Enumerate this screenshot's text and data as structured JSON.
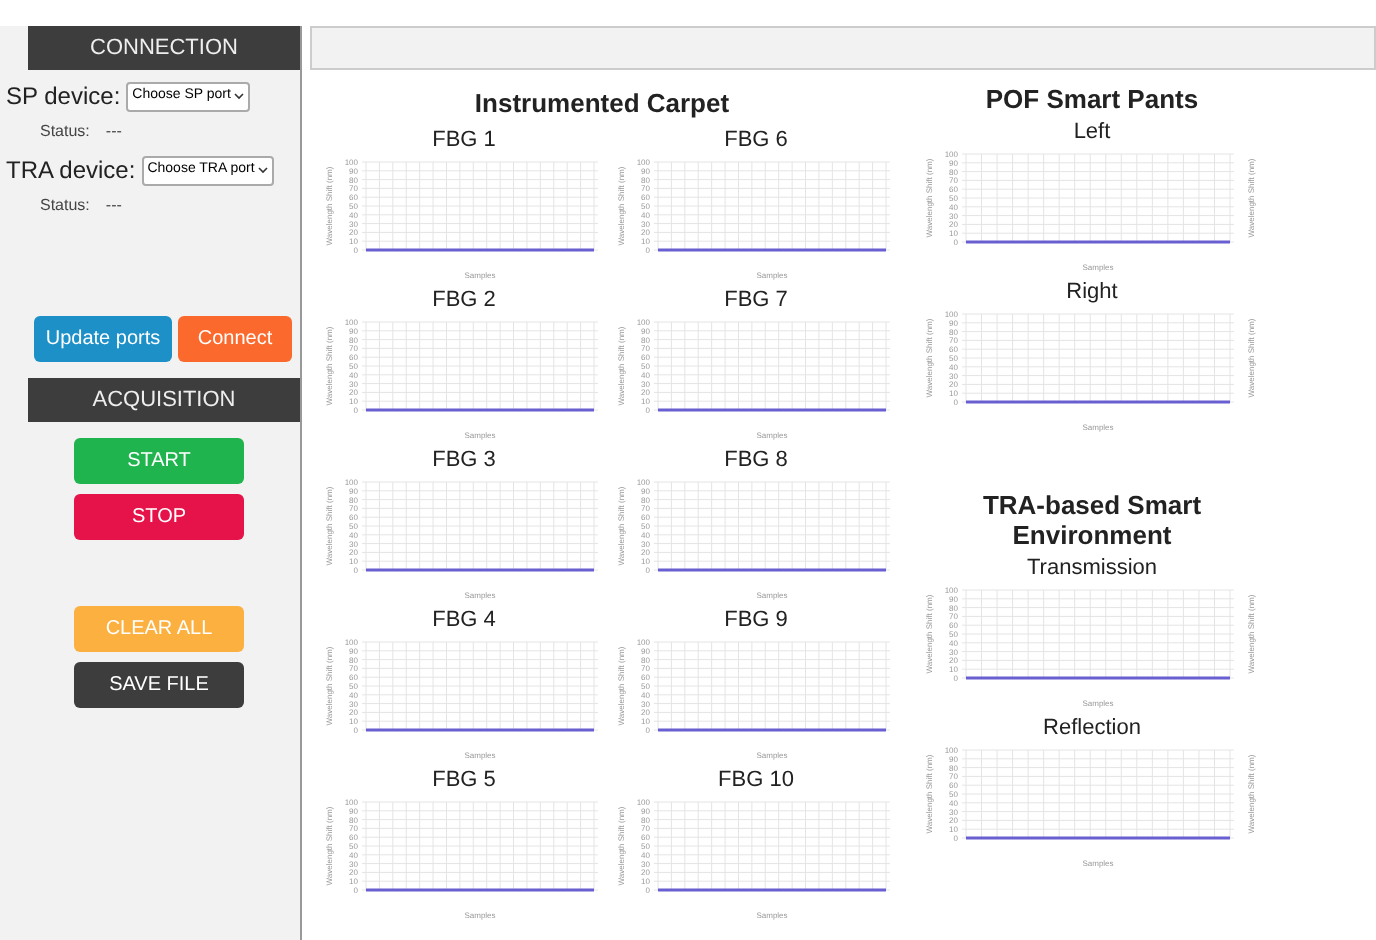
{
  "sidebar": {
    "connection_header": "CONNECTION",
    "devices": [
      {
        "label": "SP device:",
        "port": "Choose SP port",
        "status_label": "Status:",
        "status": "---"
      },
      {
        "label": "TRA device:",
        "port": "Choose TRA port",
        "status_label": "Status:",
        "status": "---"
      }
    ],
    "port_buttons": [
      {
        "label": "Update ports",
        "color": "#1e90c8"
      },
      {
        "label": "Connect",
        "color": "#fb6a2c"
      }
    ],
    "acquisition_header": "ACQUISITION",
    "acquisition_buttons": [
      {
        "label": "START",
        "color": "#1fb44e"
      },
      {
        "label": "STOP",
        "color": "#e5134a"
      }
    ],
    "file_buttons": [
      {
        "label": "CLEAR ALL",
        "color": "#fbb040"
      },
      {
        "label": "SAVE FILE",
        "color": "#3d3d3d"
      }
    ]
  },
  "carpet": {
    "title": "Instrumented Carpet",
    "charts": [
      {
        "title": "FBG 1",
        "chart_data": {
          "type": "line",
          "grid": true,
          "xlabel": "Samples",
          "ylabel": "Wavelength Shift (nm)",
          "ylim": [
            0,
            100
          ],
          "yticks": [
            0,
            10,
            20,
            30,
            40,
            50,
            60,
            70,
            80,
            90,
            100
          ],
          "series": [
            {
              "color": "#6a5fd0",
              "values": [
                0,
                0,
                0,
                0,
                0,
                0,
                0,
                0,
                0,
                0,
                0,
                0,
                0,
                0,
                0,
                0,
                0,
                0
              ]
            }
          ]
        }
      },
      {
        "title": "FBG 6",
        "chart_data": {
          "type": "line",
          "grid": true,
          "xlabel": "Samples",
          "ylabel": "Wavelength Shift (nm)",
          "ylim": [
            0,
            100
          ],
          "yticks": [
            0,
            10,
            20,
            30,
            40,
            50,
            60,
            70,
            80,
            90,
            100
          ],
          "series": [
            {
              "color": "#6a5fd0",
              "values": [
                0,
                0,
                0,
                0,
                0,
                0,
                0,
                0,
                0,
                0,
                0,
                0,
                0,
                0,
                0,
                0,
                0,
                0
              ]
            }
          ]
        }
      },
      {
        "title": "FBG 2",
        "chart_data": {
          "type": "line",
          "grid": true,
          "xlabel": "Samples",
          "ylabel": "Wavelength Shift (nm)",
          "ylim": [
            0,
            100
          ],
          "yticks": [
            0,
            10,
            20,
            30,
            40,
            50,
            60,
            70,
            80,
            90,
            100
          ],
          "series": [
            {
              "color": "#6a5fd0",
              "values": [
                0,
                0,
                0,
                0,
                0,
                0,
                0,
                0,
                0,
                0,
                0,
                0,
                0,
                0,
                0,
                0,
                0,
                0
              ]
            }
          ]
        }
      },
      {
        "title": "FBG 7",
        "chart_data": {
          "type": "line",
          "grid": true,
          "xlabel": "Samples",
          "ylabel": "Wavelength Shift (nm)",
          "ylim": [
            0,
            100
          ],
          "yticks": [
            0,
            10,
            20,
            30,
            40,
            50,
            60,
            70,
            80,
            90,
            100
          ],
          "series": [
            {
              "color": "#6a5fd0",
              "values": [
                0,
                0,
                0,
                0,
                0,
                0,
                0,
                0,
                0,
                0,
                0,
                0,
                0,
                0,
                0,
                0,
                0,
                0
              ]
            }
          ]
        }
      },
      {
        "title": "FBG 3",
        "chart_data": {
          "type": "line",
          "grid": true,
          "xlabel": "Samples",
          "ylabel": "Wavelength Shift (nm)",
          "ylim": [
            0,
            100
          ],
          "yticks": [
            0,
            10,
            20,
            30,
            40,
            50,
            60,
            70,
            80,
            90,
            100
          ],
          "series": [
            {
              "color": "#6a5fd0",
              "values": [
                0,
                0,
                0,
                0,
                0,
                0,
                0,
                0,
                0,
                0,
                0,
                0,
                0,
                0,
                0,
                0,
                0,
                0
              ]
            }
          ]
        }
      },
      {
        "title": "FBG 8",
        "chart_data": {
          "type": "line",
          "grid": true,
          "xlabel": "Samples",
          "ylabel": "Wavelength Shift (nm)",
          "ylim": [
            0,
            100
          ],
          "yticks": [
            0,
            10,
            20,
            30,
            40,
            50,
            60,
            70,
            80,
            90,
            100
          ],
          "series": [
            {
              "color": "#6a5fd0",
              "values": [
                0,
                0,
                0,
                0,
                0,
                0,
                0,
                0,
                0,
                0,
                0,
                0,
                0,
                0,
                0,
                0,
                0,
                0
              ]
            }
          ]
        }
      },
      {
        "title": "FBG 4",
        "chart_data": {
          "type": "line",
          "grid": true,
          "xlabel": "Samples",
          "ylabel": "Wavelength Shift (nm)",
          "ylim": [
            0,
            100
          ],
          "yticks": [
            0,
            10,
            20,
            30,
            40,
            50,
            60,
            70,
            80,
            90,
            100
          ],
          "series": [
            {
              "color": "#6a5fd0",
              "values": [
                0,
                0,
                0,
                0,
                0,
                0,
                0,
                0,
                0,
                0,
                0,
                0,
                0,
                0,
                0,
                0,
                0,
                0
              ]
            }
          ]
        }
      },
      {
        "title": "FBG 9",
        "chart_data": {
          "type": "line",
          "grid": true,
          "xlabel": "Samples",
          "ylabel": "Wavelength Shift (nm)",
          "ylim": [
            0,
            100
          ],
          "yticks": [
            0,
            10,
            20,
            30,
            40,
            50,
            60,
            70,
            80,
            90,
            100
          ],
          "series": [
            {
              "color": "#6a5fd0",
              "values": [
                0,
                0,
                0,
                0,
                0,
                0,
                0,
                0,
                0,
                0,
                0,
                0,
                0,
                0,
                0,
                0,
                0,
                0
              ]
            }
          ]
        }
      },
      {
        "title": "FBG 5",
        "chart_data": {
          "type": "line",
          "grid": true,
          "xlabel": "Samples",
          "ylabel": "Wavelength Shift (nm)",
          "ylim": [
            0,
            100
          ],
          "yticks": [
            0,
            10,
            20,
            30,
            40,
            50,
            60,
            70,
            80,
            90,
            100
          ],
          "series": [
            {
              "color": "#6a5fd0",
              "values": [
                0,
                0,
                0,
                0,
                0,
                0,
                0,
                0,
                0,
                0,
                0,
                0,
                0,
                0,
                0,
                0,
                0,
                0
              ]
            }
          ]
        }
      },
      {
        "title": "FBG 10",
        "chart_data": {
          "type": "line",
          "grid": true,
          "xlabel": "Samples",
          "ylabel": "Wavelength Shift (nm)",
          "ylim": [
            0,
            100
          ],
          "yticks": [
            0,
            10,
            20,
            30,
            40,
            50,
            60,
            70,
            80,
            90,
            100
          ],
          "series": [
            {
              "color": "#6a5fd0",
              "values": [
                0,
                0,
                0,
                0,
                0,
                0,
                0,
                0,
                0,
                0,
                0,
                0,
                0,
                0,
                0,
                0,
                0,
                0
              ]
            }
          ]
        }
      }
    ]
  },
  "sections": [
    {
      "title": "POF Smart Pants",
      "charts": [
        {
          "title": "Left",
          "chart_data": {
            "type": "line",
            "grid": true,
            "xlabel": "Samples",
            "ylabel": "Wavelength Shift (nm)",
            "ylim": [
              0,
              100
            ],
            "yticks": [
              0,
              10,
              20,
              30,
              40,
              50,
              60,
              70,
              80,
              90,
              100
            ],
            "series": [
              {
                "color": "#6a5fd0",
                "values": [
                  0,
                  0,
                  0,
                  0,
                  0,
                  0,
                  0,
                  0,
                  0,
                  0,
                  0,
                  0,
                  0,
                  0,
                  0,
                  0,
                  0,
                  0
                ]
              }
            ]
          }
        },
        {
          "title": "Right",
          "chart_data": {
            "type": "line",
            "grid": true,
            "xlabel": "Samples",
            "ylabel": "Wavelength Shift (nm)",
            "ylim": [
              0,
              100
            ],
            "yticks": [
              0,
              10,
              20,
              30,
              40,
              50,
              60,
              70,
              80,
              90,
              100
            ],
            "series": [
              {
                "color": "#6a5fd0",
                "values": [
                  0,
                  0,
                  0,
                  0,
                  0,
                  0,
                  0,
                  0,
                  0,
                  0,
                  0,
                  0,
                  0,
                  0,
                  0,
                  0,
                  0,
                  0
                ]
              }
            ]
          }
        }
      ]
    },
    {
      "title": "TRA-based Smart Environment",
      "charts": [
        {
          "title": "Transmission",
          "chart_data": {
            "type": "line",
            "grid": true,
            "xlabel": "Samples",
            "ylabel": "Wavelength Shift (nm)",
            "ylim": [
              0,
              100
            ],
            "yticks": [
              0,
              10,
              20,
              30,
              40,
              50,
              60,
              70,
              80,
              90,
              100
            ],
            "series": [
              {
                "color": "#6a5fd0",
                "values": [
                  0,
                  0,
                  0,
                  0,
                  0,
                  0,
                  0,
                  0,
                  0,
                  0,
                  0,
                  0,
                  0,
                  0,
                  0,
                  0,
                  0,
                  0
                ]
              }
            ]
          }
        },
        {
          "title": "Reflection",
          "chart_data": {
            "type": "line",
            "grid": true,
            "xlabel": "Samples",
            "ylabel": "Wavelength Shift (nm)",
            "ylim": [
              0,
              100
            ],
            "yticks": [
              0,
              10,
              20,
              30,
              40,
              50,
              60,
              70,
              80,
              90,
              100
            ],
            "series": [
              {
                "color": "#6a5fd0",
                "values": [
                  0,
                  0,
                  0,
                  0,
                  0,
                  0,
                  0,
                  0,
                  0,
                  0,
                  0,
                  0,
                  0,
                  0,
                  0,
                  0,
                  0,
                  0
                ]
              }
            ]
          }
        }
      ]
    }
  ]
}
